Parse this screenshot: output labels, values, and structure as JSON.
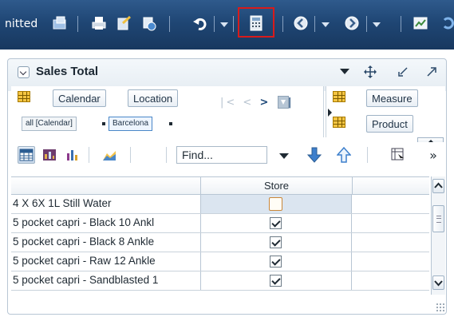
{
  "toolbar": {
    "title_fragment": "nitted",
    "icons": [
      "publish-icon",
      "print-icon",
      "save-as-icon",
      "refresh-icon",
      "undo-icon",
      "calculator-icon",
      "back-icon",
      "forward-icon",
      "chart-icon",
      "refresh-alt-icon"
    ],
    "highlight_color": "#d81b1b"
  },
  "panel": {
    "title": "Sales Total",
    "header_icons": [
      "dropdown-icon",
      "move-icon",
      "minimize-icon",
      "maximize-icon"
    ]
  },
  "layout": {
    "row_edge": {
      "dimensions": [
        "Calendar",
        "Location"
      ],
      "members": [
        "all [Calendar]",
        "Barcelona"
      ]
    },
    "page_edge": {
      "dimensions": [
        "Measure",
        "Product"
      ]
    }
  },
  "table_toolbar": {
    "find_placeholder": "Find...",
    "view_buttons": [
      "table-view-icon",
      "table-chart-view-icon",
      "chart-view-icon",
      "area-chart-icon"
    ]
  },
  "grid": {
    "column_header": "Store",
    "rows": [
      {
        "label": "4 X 6X 1L Still Water",
        "checked": false,
        "selected": true
      },
      {
        "label": "5 pocket capri - Black 10 Ankl",
        "checked": true,
        "selected": false
      },
      {
        "label": "5 pocket capri - Black 8 Ankle",
        "checked": true,
        "selected": false
      },
      {
        "label": "5 pocket capri - Raw 12 Ankle",
        "checked": true,
        "selected": false
      },
      {
        "label": "5 pocket capri - Sandblasted 1",
        "checked": true,
        "selected": false
      }
    ]
  }
}
